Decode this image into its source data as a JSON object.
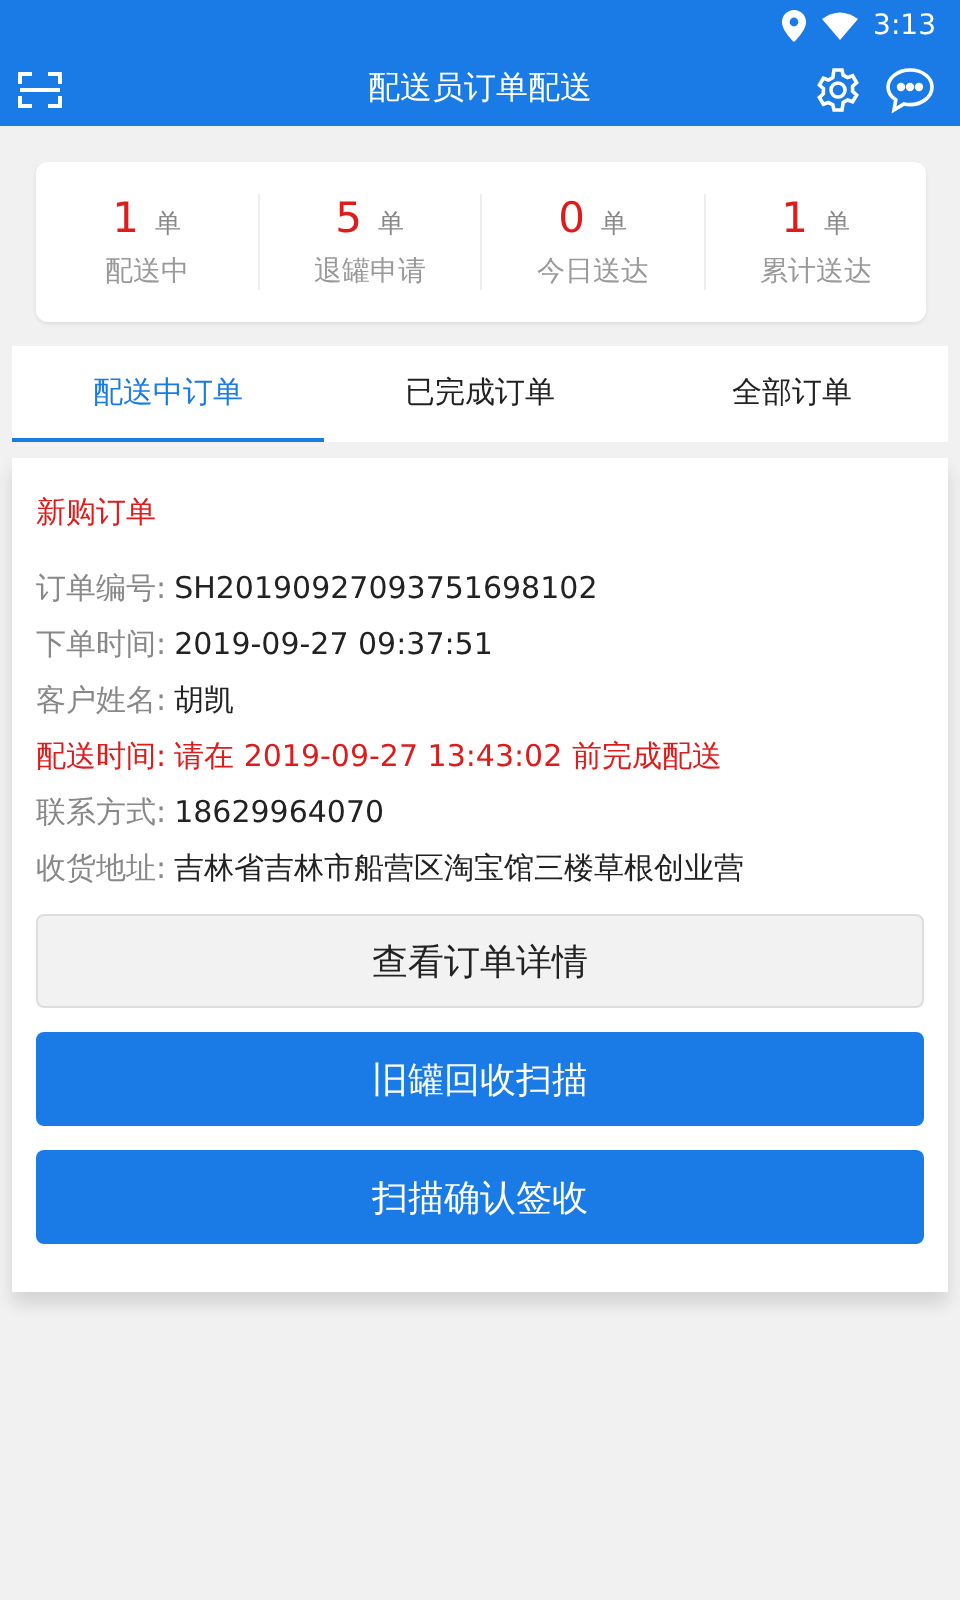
{
  "status_bar": {
    "time": "3:13"
  },
  "app_bar": {
    "title": "配送员订单配送"
  },
  "stats": [
    {
      "count": "1",
      "unit": "单",
      "label": "配送中"
    },
    {
      "count": "5",
      "unit": "单",
      "label": "退罐申请"
    },
    {
      "count": "0",
      "unit": "单",
      "label": "今日送达"
    },
    {
      "count": "1",
      "unit": "单",
      "label": "累计送达"
    }
  ],
  "tabs": [
    {
      "label": "配送中订单",
      "selected": true
    },
    {
      "label": "已完成订单",
      "selected": false
    },
    {
      "label": "全部订单",
      "selected": false
    }
  ],
  "order": {
    "type": "新购订单",
    "fields": [
      {
        "kind": "normal",
        "label": "订单编号:",
        "value": "SH20190927093751698102"
      },
      {
        "kind": "normal",
        "label": "下单时间:",
        "value": "2019-09-27 09:37:51"
      },
      {
        "kind": "normal",
        "label": "客户姓名:",
        "value": "胡凯"
      },
      {
        "kind": "alert",
        "label": "配送时间:",
        "value": "请在 2019-09-27 13:43:02 前完成配送"
      },
      {
        "kind": "normal",
        "label": "联系方式:",
        "value": "18629964070"
      },
      {
        "kind": "normal",
        "label": "收货地址:",
        "value": "吉林省吉林市船营区淘宝馆三楼草根创业营"
      }
    ],
    "buttons": [
      {
        "kind": "secondary",
        "label": "查看订单详情"
      },
      {
        "kind": "primary",
        "label": "旧罐回收扫描"
      },
      {
        "kind": "primary",
        "label": "扫描确认签收"
      }
    ]
  }
}
